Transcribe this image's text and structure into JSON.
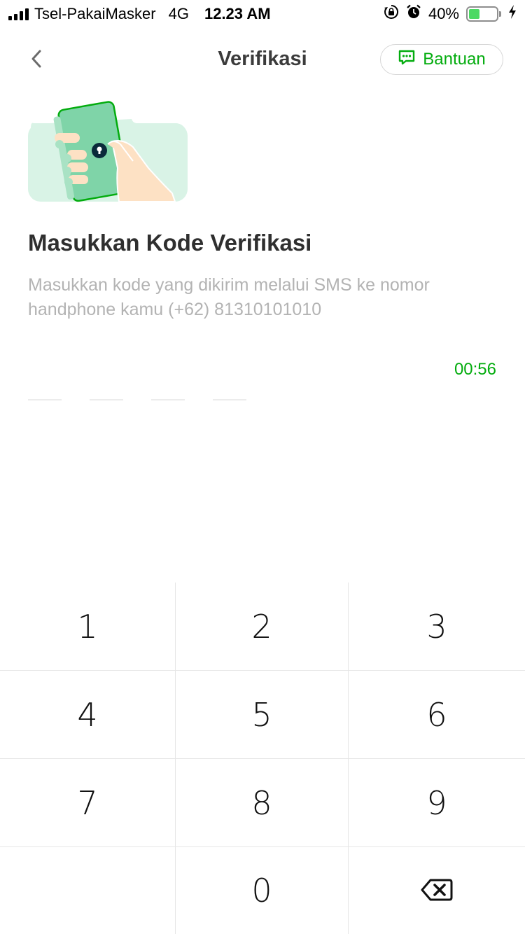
{
  "status_bar": {
    "carrier": "Tsel-PakaiMasker",
    "network": "4G",
    "time": "12.23 AM",
    "battery_percent_label": "40%",
    "battery_level": 0.4,
    "icons": [
      "signal-icon",
      "orientation-lock-icon",
      "alarm-icon",
      "battery-icon",
      "charging-icon"
    ]
  },
  "header": {
    "title": "Verifikasi",
    "help_label": "Bantuan",
    "icons": [
      "back-chevron-icon",
      "chat-bubble-icon"
    ]
  },
  "main": {
    "heading": "Masukkan Kode Verifikasi",
    "description": "Masukkan kode yang dikirim melalui SMS ke nomor handphone kamu (+62) 81310101010",
    "timer": "00:56",
    "otp_length": 4
  },
  "keypad": {
    "keys": [
      "1",
      "2",
      "3",
      "4",
      "5",
      "6",
      "7",
      "8",
      "9",
      "",
      "0",
      "backspace"
    ],
    "icons": [
      "backspace-icon"
    ]
  },
  "colors": {
    "accent": "#03ac0e",
    "illustration_bg": "#d9f3e6",
    "phone": "#7fd4a8",
    "skin": "#fde1c4",
    "muted_text": "#b3b3b3"
  }
}
